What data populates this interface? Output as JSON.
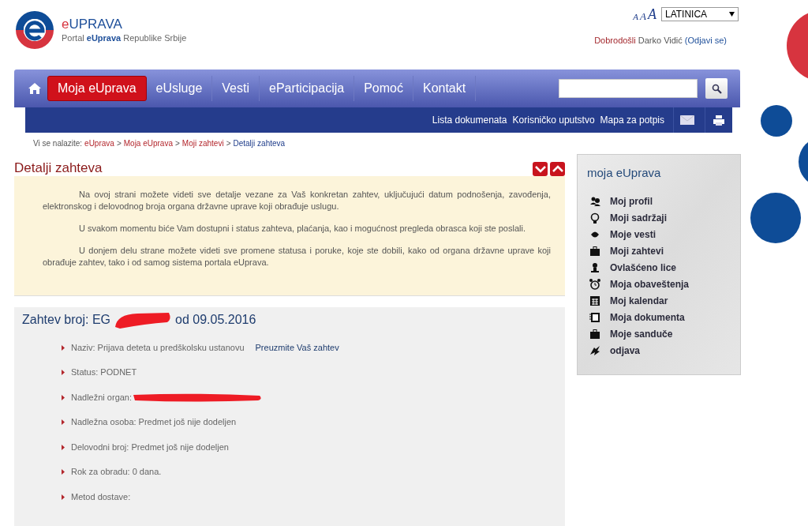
{
  "header": {
    "site_title": {
      "prefix": "e",
      "rest": "UPRAVA"
    },
    "subtitle": "Portal **eUprava** Republike Srbije",
    "font_size_buttons": [
      "A",
      "A",
      "A"
    ],
    "script_select": "LATINICA",
    "welcome": "Dobrodošli",
    "user_name": "Darko Vidić",
    "logout": "(Odjavi se)"
  },
  "nav": {
    "items": [
      {
        "label": "Moja eUprava",
        "selected": true
      },
      {
        "label": "eUsluge",
        "selected": false
      },
      {
        "label": "Vesti",
        "selected": false
      },
      {
        "label": "eParticipacija",
        "selected": false
      },
      {
        "label": "Pomoć",
        "selected": false
      },
      {
        "label": "Kontakt",
        "selected": false
      }
    ]
  },
  "subnav": {
    "links": [
      "Lista dokumenata",
      "Korisničko uputstvo",
      "Mapa za potpis"
    ]
  },
  "breadcrumb": {
    "prefix": "Vi se nalazite:",
    "items": [
      {
        "kind": "link",
        "text": "eUprava"
      },
      {
        "kind": "separator",
        "text": ">"
      },
      {
        "kind": "link",
        "text": "Moja eUprava"
      },
      {
        "kind": "separator",
        "text": ">"
      },
      {
        "kind": "link",
        "text": "Moji zahtevi"
      },
      {
        "kind": "separator",
        "text": ">"
      },
      {
        "kind": "current",
        "text": "Detalji zahteva"
      }
    ]
  },
  "intro": {
    "title": "Detalji zahteva",
    "paragraphs": [
      "Na ovoj strani možete videti sve detalje vezane za Vaš konkretan zahtev, uključujući datum podnošenja, zavođenja, elektronskog i delovodnog broja organa državne uprave koji obrađuje uslugu.",
      "U svakom momentu biće Vam dostupni i status zahteva, plaćanja, kao i mogućnost pregleda obrasca koji ste poslali.",
      "U donjem delu strane možete videti sve promene statusa i poruke, koje ste dobili, kako od organa državne uprave koji obrađuje zahtev, tako i od samog sistema portala eUprava."
    ]
  },
  "request": {
    "heading_start": "Zahtev broj: EG",
    "heading_redacted": true,
    "heading_end": "od 09.05.2016",
    "fields": [
      {
        "text": "Naziv: Prijava deteta u predškolsku ustanovu",
        "link": "Preuzmite Vaš zahtev",
        "redacted": false
      },
      {
        "text": "Status: PODNET",
        "redacted": false
      },
      {
        "text": "Nadležni organ:",
        "redacted": true
      },
      {
        "text": "Nadležna osoba: Predmet još nije dodeljen",
        "redacted": false
      },
      {
        "text": "Delovodni broj: Predmet još nije dodeljen",
        "redacted": false
      },
      {
        "text": "Rok za obradu: 0 dana.",
        "redacted": false
      },
      {
        "text": "Metod dostave:",
        "redacted": false
      }
    ]
  },
  "sidebar": {
    "title": "moja eUprava",
    "items": [
      "Moj profil",
      "Moji sadržaji",
      "Moje vesti",
      "Moji zahtevi",
      "Ovlašćeno lice",
      "Moja obaveštenja",
      "Moj kalendar",
      "Moja dokumenta",
      "Moje sanduče",
      "odjava"
    ]
  }
}
